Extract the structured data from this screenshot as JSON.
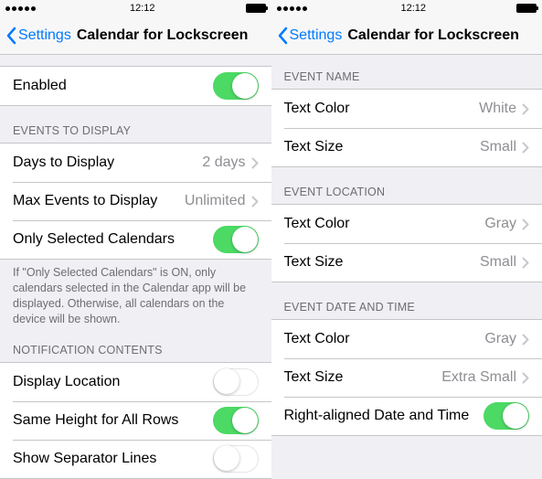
{
  "status": {
    "time": "12:12"
  },
  "nav": {
    "back": "Settings",
    "title": "Calendar for Lockscreen"
  },
  "left": {
    "enabled": "Enabled",
    "sections": {
      "eventsToDisplay": "EVENTS TO DISPLAY",
      "notificationContents": "NOTIFICATION CONTENTS"
    },
    "rows": {
      "daysToDisplay": {
        "label": "Days to Display",
        "value": "2 days"
      },
      "maxEvents": {
        "label": "Max Events to Display",
        "value": "Unlimited"
      },
      "onlySelected": {
        "label": "Only Selected Calendars"
      },
      "displayLocation": {
        "label": "Display Location"
      },
      "sameHeight": {
        "label": "Same Height for All Rows"
      },
      "separator": {
        "label": "Show Separator Lines"
      }
    },
    "footer": "If \"Only Selected Calendars\" is ON, only calendars selected in the Calendar app will be displayed. Otherwise, all calendars on the device will be shown."
  },
  "right": {
    "sections": {
      "eventName": "EVENT NAME",
      "eventLocation": "EVENT LOCATION",
      "eventDateTime": "EVENT DATE AND TIME"
    },
    "rows": {
      "nameColor": {
        "label": "Text Color",
        "value": "White"
      },
      "nameSize": {
        "label": "Text Size",
        "value": "Small"
      },
      "locColor": {
        "label": "Text Color",
        "value": "Gray"
      },
      "locSize": {
        "label": "Text Size",
        "value": "Small"
      },
      "dtColor": {
        "label": "Text Color",
        "value": "Gray"
      },
      "dtSize": {
        "label": "Text Size",
        "value": "Extra Small"
      },
      "rightAligned": {
        "label": "Right-aligned Date and Time"
      }
    }
  }
}
